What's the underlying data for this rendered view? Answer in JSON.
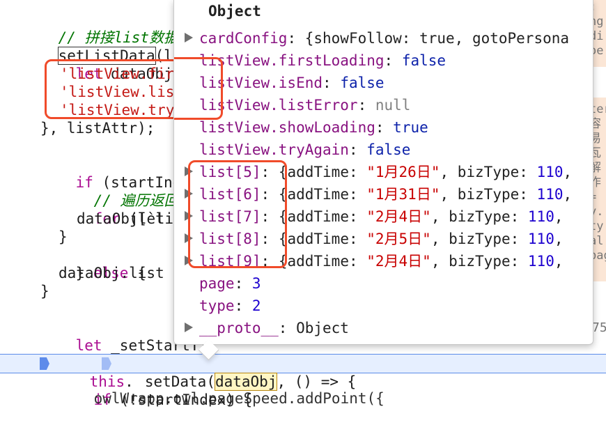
{
  "code": {
    "comment1": "// 拼接list数据, 防",
    "fn_name": "setListData",
    "fn_rest": "(listA",
    "line_let_prefix": "let ",
    "line_let_var": "dataObj",
    "line_let_rest": " = {",
    "str1": "'listView.fir",
    "str2": "'listView.lis",
    "str3": "'listView.try",
    "close_attr": "}, listAttr);",
    "if_kw": "if",
    "if_rest": " (startIndex)",
    "comment2": "// 遍历返回数据",
    "for_kw": "for",
    "for_rest": " (let [ind",
    "dataobj_index": "dataObj[`li",
    "close_brace1": "}",
    "else_close": "} ",
    "else_kw": "else",
    "else_rest": " {",
    "dataobj_list": "dataObj.list",
    "close_brace2": "}",
    "let_set_kw": "let",
    "let_set_rest": " _setStartTi",
    "this_kw": "this",
    "set_data_dot": ".",
    "set_data_fn": "setData(",
    "set_data_arg": "dataObj",
    "set_data_rest": ", () => {",
    "if2_kw": "if",
    "if2_rest": " (!startIndex) {",
    "last_line": "    owlWrapp.owl.pageSpeed.addPoint({",
    "right_edge": [
      ":",
      "ng",
      "di",
      "oe",
      "",
      "",
      "",
      "ter",
      "容易",
      "瓦解",
      "作",
      "=",
      "y.",
      "ty",
      "al",
      "pag"
    ],
    "right_num": "75"
  },
  "popup": {
    "title": "Object",
    "rows": [
      {
        "expandable": true,
        "key": "cardConfig",
        "sep": ": ",
        "value": "{showFollow: true, gotoPersona",
        "vtype": "obj"
      },
      {
        "expandable": false,
        "key": "listView.firstLoading",
        "sep": ": ",
        "value": "false",
        "vtype": "bool"
      },
      {
        "expandable": false,
        "key": "listView.isEnd",
        "sep": ": ",
        "value": "false",
        "vtype": "bool"
      },
      {
        "expandable": false,
        "key": "listView.listError",
        "sep": ": ",
        "value": "null",
        "vtype": "null"
      },
      {
        "expandable": false,
        "key": "listView.showLoading",
        "sep": ": ",
        "value": "true",
        "vtype": "bool"
      },
      {
        "expandable": false,
        "key": "listView.tryAgain",
        "sep": ": ",
        "value": "false",
        "vtype": "bool"
      },
      {
        "expandable": true,
        "key": "list[5]",
        "sep": ": ",
        "prefix": "{addTime: ",
        "date": "\"1月26日\"",
        "suffix": ", bizType: ",
        "num": "110",
        "tail": ",",
        "vtype": "list"
      },
      {
        "expandable": true,
        "key": "list[6]",
        "sep": ": ",
        "prefix": "{addTime: ",
        "date": "\"1月31日\"",
        "suffix": ", bizType: ",
        "num": "110",
        "tail": ",",
        "vtype": "list"
      },
      {
        "expandable": true,
        "key": "list[7]",
        "sep": ": ",
        "prefix": "{addTime: ",
        "date": "\"2月4日\"",
        "suffix": ", bizType: ",
        "num": "110",
        "tail": ",",
        "vtype": "list"
      },
      {
        "expandable": true,
        "key": "list[8]",
        "sep": ": ",
        "prefix": "{addTime: ",
        "date": "\"2月5日\"",
        "suffix": ", bizType: ",
        "num": "110",
        "tail": ",",
        "vtype": "list"
      },
      {
        "expandable": true,
        "key": "list[9]",
        "sep": ": ",
        "prefix": "{addTime: ",
        "date": "\"2月4日\"",
        "suffix": ", bizType: ",
        "num": "110",
        "tail": ",",
        "vtype": "list"
      },
      {
        "expandable": false,
        "key": "page",
        "sep": ": ",
        "value": "3",
        "vtype": "num"
      },
      {
        "expandable": false,
        "key": "type",
        "sep": ": ",
        "value": "2",
        "vtype": "num"
      },
      {
        "expandable": true,
        "key": "__proto__",
        "sep": ": ",
        "value": "Object",
        "vtype": "obj"
      }
    ]
  },
  "colors": {
    "annotation_box": "#f04b2a",
    "execution_line": "#e6efff",
    "breakpoint": "#4f7fe8"
  }
}
